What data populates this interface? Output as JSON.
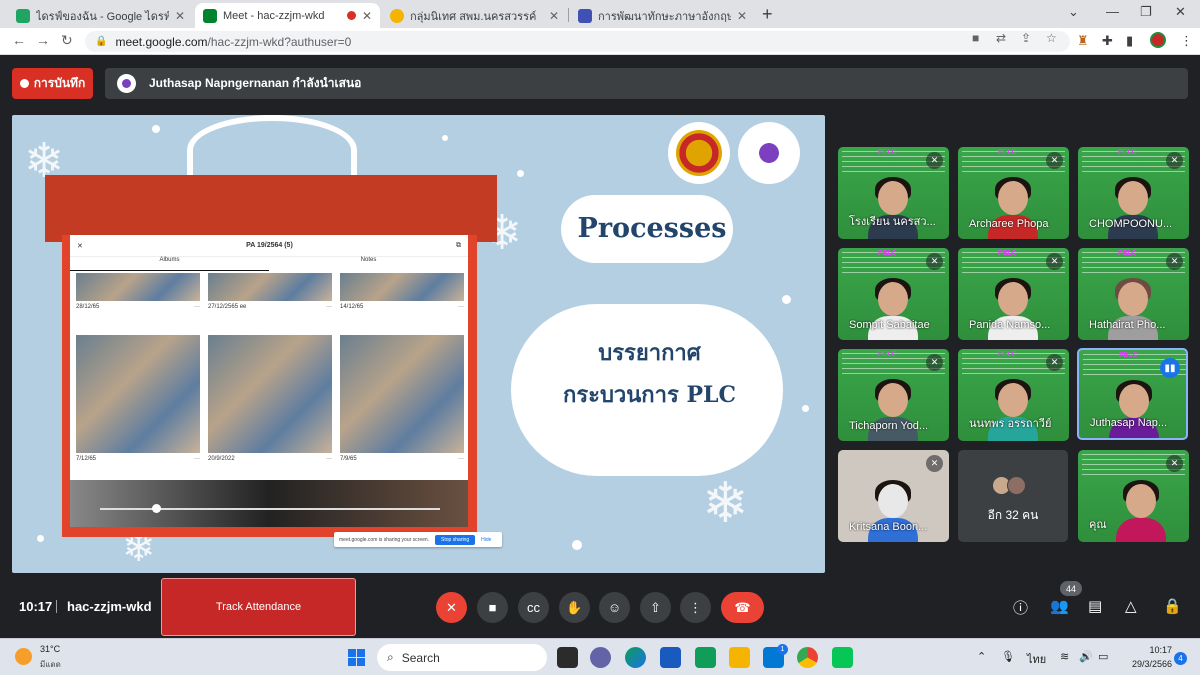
{
  "browser": {
    "tabs": [
      {
        "title": "ไดรฟ์ของฉัน - Google ไดรฟ์",
        "favicon_color": "#1fa463"
      },
      {
        "title": "Meet - hac-zzjm-wkd",
        "favicon_color": "#00832d",
        "active": true
      },
      {
        "title": "กลุ่มนิเทศ สพม.นครสวรรค์",
        "favicon_color": "#f4b400"
      },
      {
        "title": "การพัฒนาทักษะภาษาอังกฤษ English",
        "favicon_color": "#3f51b5"
      }
    ],
    "url_host": "meet.google.com",
    "url_path": "/hac-zzjm-wkd?authuser=0"
  },
  "meet": {
    "record_label": "การบันทึก",
    "presenter_text": "Juthasap Napngernanan กำลังนำเสนอ",
    "slide": {
      "title": "Processes",
      "line1": "บรรยากาศ",
      "line2": "กระบวนการ PLC",
      "album_title": "PA 19/2564 (5)",
      "album_tab1": "Albums",
      "album_tab2": "Notes",
      "photo_dates": [
        "28/12/65",
        "27/12/2565 ee",
        "14/12/65",
        "7/12/65",
        "20/9/2022",
        "7/9/65"
      ],
      "share_text": "meet.google.com is sharing your screen.",
      "share_stop": "Stop sharing",
      "share_hide": "Hide"
    },
    "participants": [
      {
        "name": "โรงเรียน นครสว...",
        "muted": true
      },
      {
        "name": "Archaree Phopa",
        "muted": true
      },
      {
        "name": "CHOMPOONU...",
        "muted": true
      },
      {
        "name": "Sompit Sabaitae",
        "muted": true
      },
      {
        "name": "Panida Namso...",
        "muted": true
      },
      {
        "name": "Hathairat Pho...",
        "muted": true
      },
      {
        "name": "Tichaporn Yod...",
        "muted": true
      },
      {
        "name": "นนทพร อรรถาวีย์",
        "muted": true
      },
      {
        "name": "Juthasap Nap...",
        "speaking": true
      },
      {
        "name": "Kritsana Boon...",
        "muted": true
      },
      {
        "name": "คุณ",
        "muted": true
      }
    ],
    "more_label": "อีก 32 คน",
    "time": "10:17",
    "meeting_code": "hac-zzjm-wkd",
    "track_attendance": "Track Attendance",
    "people_count": "44"
  },
  "taskbar": {
    "temperature": "31°C",
    "condition": "มีแดด",
    "search": "Search",
    "lang": "ไทย",
    "time": "10:17",
    "date": "29/3/2566",
    "notifications": "4",
    "mail_badge": "1"
  }
}
